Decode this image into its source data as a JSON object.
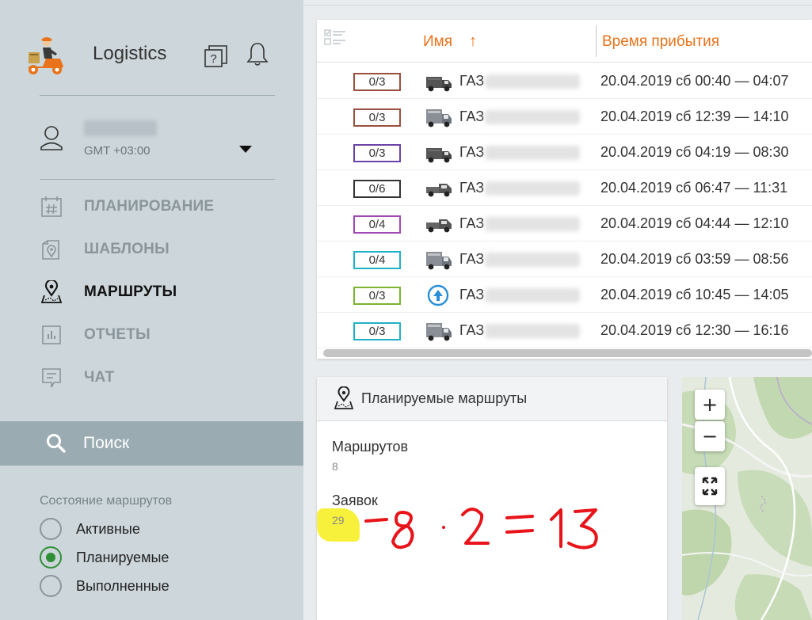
{
  "app": {
    "title": "Logistics"
  },
  "user": {
    "name": "salagin",
    "timezone": "GMT +03:00"
  },
  "nav": [
    {
      "label": "ПЛАНИРОВАНИЕ",
      "icon": "calendar-grid-icon"
    },
    {
      "label": "ШАБЛОНЫ",
      "icon": "template-pin-icon"
    },
    {
      "label": "МАРШРУТЫ",
      "icon": "route-pin-icon",
      "active": true
    },
    {
      "label": "ОТЧЕТЫ",
      "icon": "report-chart-icon"
    },
    {
      "label": "ЧАТ",
      "icon": "chat-icon"
    }
  ],
  "search": {
    "label": "Поиск"
  },
  "route_state": {
    "title": "Состояние маршрутов",
    "options": [
      {
        "label": "Активные",
        "checked": false
      },
      {
        "label": "Планируемые",
        "checked": true
      },
      {
        "label": "Выполненные",
        "checked": false
      }
    ]
  },
  "table": {
    "col_name": "Имя",
    "sort_arrow": "↑",
    "col_arrival": "Время прибытия",
    "rows": [
      {
        "count": "0/3",
        "border": "#9a4f3f",
        "vehicle": "truck-dark",
        "name": "ГАЗ",
        "hidden": "796 ККХ 7-",
        "arrival": "20.04.2019 сб 00:40 — 04:07"
      },
      {
        "count": "0/3",
        "border": "#9a4f3f",
        "vehicle": "van",
        "name": "ГАЗ",
        "hidden": "ЕЛЬ 134 Т-",
        "arrival": "20.04.2019 сб 12:39 — 14:10"
      },
      {
        "count": "0/3",
        "border": "#6b43a6",
        "vehicle": "truck-dark",
        "name": "ГАЗ",
        "hidden": "020 ЕМО 7-",
        "arrival": "20.04.2019 сб 04:19 — 08:30"
      },
      {
        "count": "0/6",
        "border": "#333333",
        "vehicle": "pickup",
        "name": "ГАЗ",
        "hidden": "019 ЕМО 7-",
        "arrival": "20.04.2019 сб 06:47 — 11:31"
      },
      {
        "count": "0/4",
        "border": "#a047b5",
        "vehicle": "pickup",
        "name": "ГАЗ",
        "hidden": "016 ЕТО 7-",
        "arrival": "20.04.2019 сб 04:44 — 12:10"
      },
      {
        "count": "0/4",
        "border": "#1fb2c6",
        "vehicle": "van",
        "name": "ГАЗ",
        "hidden": "ЕЛЬ 163 В-",
        "arrival": "20.04.2019 сб 03:59 — 08:56"
      },
      {
        "count": "0/3",
        "border": "#7bb52f",
        "vehicle": "arrow",
        "name": "ГАЗ",
        "hidden": "275 НТХ 1-",
        "arrival": "20.04.2019 сб 10:45 — 14:05"
      },
      {
        "count": "0/3",
        "border": "#1fb2c6",
        "vehicle": "van",
        "name": "ГАЗ",
        "hidden": "ЕЛЬ 860 У-",
        "arrival": "20.04.2019 сб 12:30 — 16:16"
      }
    ]
  },
  "planned": {
    "title": "Планируемые маршруты",
    "routes_label": "Маршрутов",
    "routes_value": "8",
    "orders_label": "Заявок",
    "orders_value": "29",
    "annotation": "-8 · 2 = 13"
  },
  "map": {
    "zoom_in": "+",
    "zoom_out": "−"
  },
  "colors": {
    "accent": "#e8731b",
    "sidebar": "#cdd6da",
    "search_bar": "#9aacb2",
    "radio_checked": "#2f8f35",
    "annotation": "#e8141a",
    "highlight": "#f6ef1a"
  }
}
